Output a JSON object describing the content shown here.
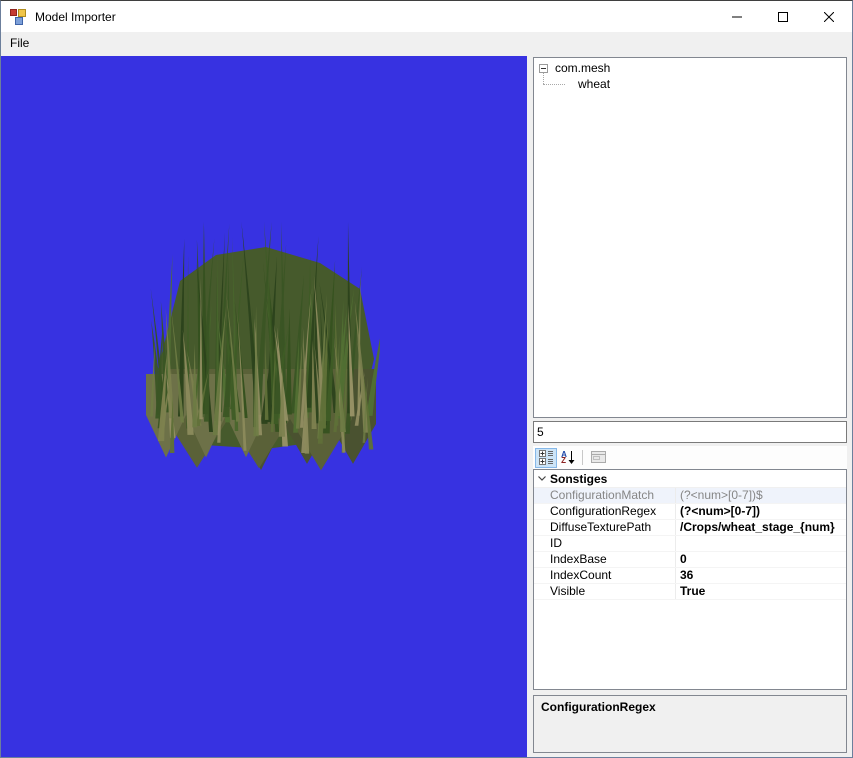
{
  "window": {
    "title": "Model Importer"
  },
  "menu": {
    "items": [
      {
        "label": "File"
      }
    ]
  },
  "tree": {
    "root": "com.mesh",
    "children": [
      "wheat"
    ]
  },
  "model_index_input": {
    "value": "5"
  },
  "property_grid": {
    "toolbar": {
      "buttons": [
        "categorized",
        "alphabetical-sort",
        "property-pages"
      ],
      "selected": "categorized"
    },
    "category": "Sonstiges",
    "rows": [
      {
        "name": "ConfigurationMatch",
        "value": "(?<num>[0-7])$",
        "state": "readonly"
      },
      {
        "name": "ConfigurationRegex",
        "value": "(?<num>[0-7])",
        "state": "modified"
      },
      {
        "name": "DiffuseTexturePath",
        "value": "/Crops/wheat_stage_{num}",
        "state": "modified"
      },
      {
        "name": "ID",
        "value": "",
        "state": "normal"
      },
      {
        "name": "IndexBase",
        "value": "0",
        "state": "modified"
      },
      {
        "name": "IndexCount",
        "value": "36",
        "state": "modified"
      },
      {
        "name": "Visible",
        "value": "True",
        "state": "modified"
      }
    ],
    "help": {
      "title": "ConfigurationRegex"
    }
  },
  "viewport": {
    "model": "wheat-grass-patch",
    "background": "#3732e1",
    "grass": {
      "dark_palette": [
        "#2c431c",
        "#35511f",
        "#3f5c26",
        "#48662c",
        "#516f33",
        "#3a5524"
      ],
      "light_palette": [
        "#6d7b44",
        "#7d814f",
        "#8b8a5b",
        "#969165",
        "#5f7038"
      ],
      "band_colors": [
        "#4a5230",
        "#5a6138",
        "#6d7148"
      ],
      "blob_color": "#465a2c"
    }
  },
  "colors": {
    "selected_tool_bg": "#cce4f7",
    "selected_tool_border": "#86b8e8",
    "viewport_bg": "#3732e1"
  }
}
